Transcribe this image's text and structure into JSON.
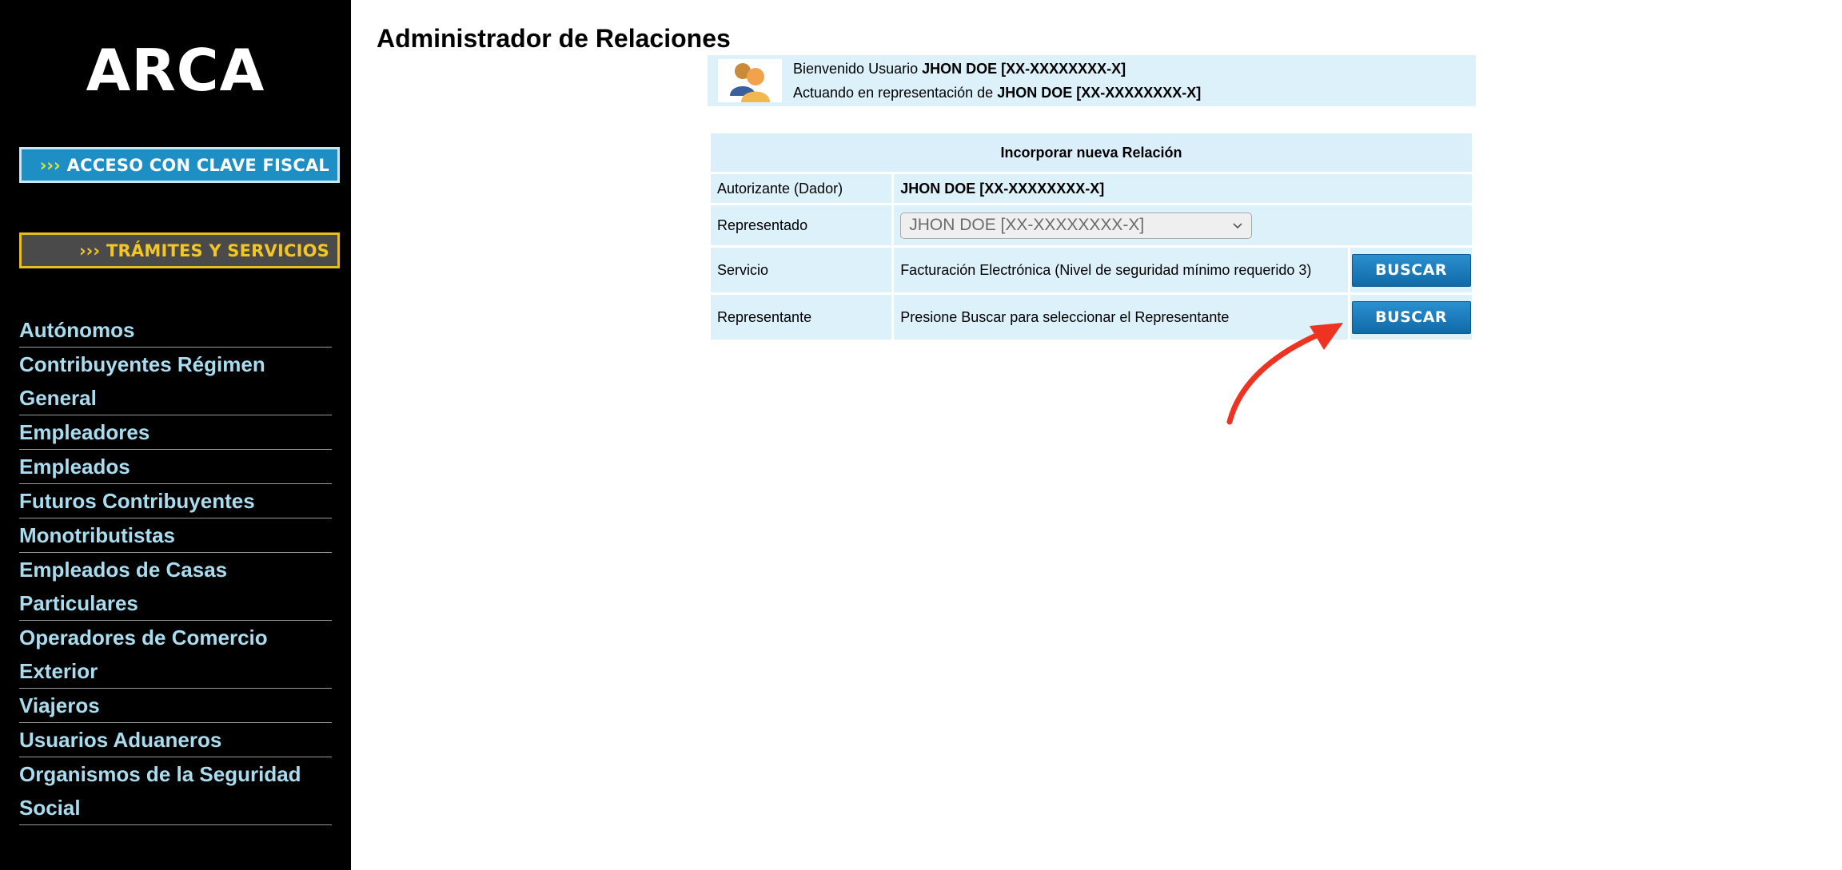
{
  "sidebar": {
    "logo": "ARCA",
    "buttons": {
      "clave_chevrons": "›››",
      "clave_label": "ACCESO CON CLAVE FISCAL",
      "tramites_chevrons": "›››",
      "tramites_label": "TRÁMITES Y SERVICIOS"
    },
    "nav_items": [
      {
        "line1": "Autónomos",
        "line2": ""
      },
      {
        "line1": "Contribuyentes Régimen",
        "line2": "General"
      },
      {
        "line1": "Empleadores",
        "line2": ""
      },
      {
        "line1": "Empleados",
        "line2": ""
      },
      {
        "line1": "Futuros Contribuyentes",
        "line2": ""
      },
      {
        "line1": "Monotributistas",
        "line2": ""
      },
      {
        "line1": "Empleados de Casas",
        "line2": "Particulares"
      },
      {
        "line1": "Operadores de Comercio",
        "line2": "Exterior"
      },
      {
        "line1": "Viajeros",
        "line2": ""
      },
      {
        "line1": "Usuarios Aduaneros",
        "line2": ""
      },
      {
        "line1": "Organismos de la Seguridad",
        "line2": "Social"
      }
    ]
  },
  "main": {
    "title": "Administrador de Relaciones",
    "welcome": {
      "line1_prefix": "Bienvenido Usuario ",
      "line1_user": "JHON DOE [XX-XXXXXXXX-X]",
      "line2_prefix": "Actuando en representación de ",
      "line2_user": "JHON DOE [XX-XXXXXXXX-X]"
    },
    "form": {
      "header": "Incorporar nueva Relación",
      "rows": [
        {
          "label": "Autorizante (Dador)",
          "value": "JHON DOE [XX-XXXXXXXX-X]"
        },
        {
          "label": "Representado",
          "select_value": "JHON DOE [XX-XXXXXXXX-X]"
        },
        {
          "label": "Servicio",
          "value": "Facturación Electrónica (Nivel de seguridad mínimo requerido 3)",
          "button": "BUSCAR"
        },
        {
          "label": "Representante",
          "value": "Presione Buscar para seleccionar el Representante",
          "button": "BUSCAR"
        }
      ]
    }
  },
  "colors": {
    "sidebar_bg": "#000000",
    "nav_link": "#a9dcef",
    "panel_bg": "#ddf1fb",
    "button_blue": "#1479bb",
    "annotation_arrow": "#ee3322"
  }
}
